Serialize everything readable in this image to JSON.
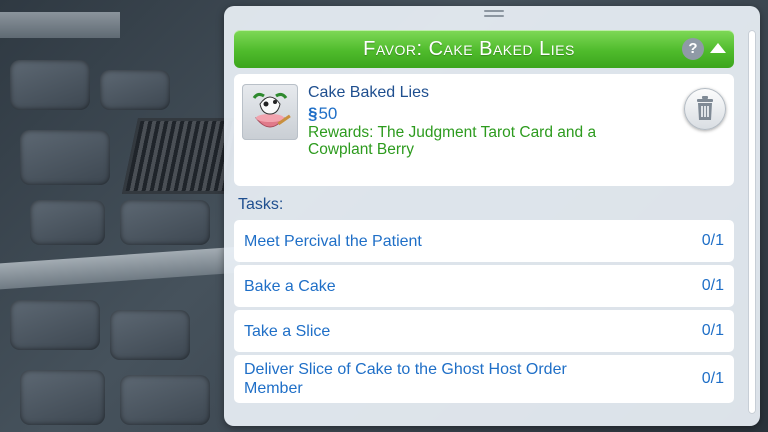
{
  "favor_panel": {
    "header_title": "Favor: Cake Baked Lies",
    "help_label": "?",
    "favor": {
      "title": "Cake Baked Lies",
      "currency_symbol": "§",
      "price": "50",
      "rewards": "Rewards: The Judgment Tarot Card and a Cowplant Berry",
      "icon": "cowplant-cake-icon"
    },
    "tasks_label": "Tasks:",
    "tasks": [
      {
        "name": "Meet Percival the Patient",
        "progress": "0/1"
      },
      {
        "name": "Bake a Cake",
        "progress": "0/1"
      },
      {
        "name": "Take a Slice",
        "progress": "0/1"
      },
      {
        "name": "Deliver Slice of Cake to the Ghost Host Order Member",
        "progress": "0/1"
      }
    ]
  },
  "colors": {
    "header_green": "#4fbb2c",
    "task_text_blue": "#1f6fc7",
    "reward_green": "#2d9b1e"
  }
}
